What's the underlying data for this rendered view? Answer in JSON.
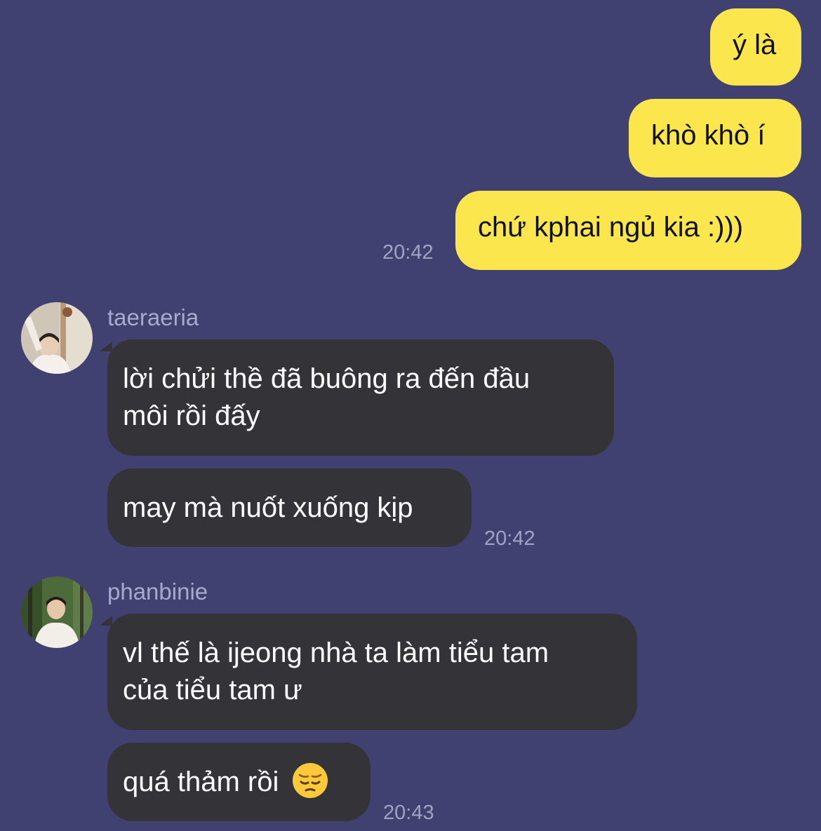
{
  "messages": {
    "outgoing": [
      {
        "text": "ý là"
      },
      {
        "text": "khò khò í"
      },
      {
        "text": "chứ kphai ngủ kia :)))"
      }
    ],
    "outgoing_time": "20:42",
    "group1": {
      "sender": "taeraeria",
      "line1": "lời chửi thề đã buông ra đến đầu",
      "line2": "môi rồi đấy",
      "line3": "may mà nuốt xuống kịp",
      "time": "20:42"
    },
    "group2": {
      "sender": "phanbinie",
      "line1": "vl thế là ijeong nhà ta làm tiểu tam",
      "line2": "của tiểu tam ư",
      "line3": "quá thảm rồi",
      "emoji": "pensive-face",
      "time": "20:43"
    }
  },
  "colors": {
    "background": "#414171",
    "outgoing_bubble": "#fbe64d",
    "incoming_bubble": "#333338",
    "timestamp": "#a2a2c4"
  }
}
